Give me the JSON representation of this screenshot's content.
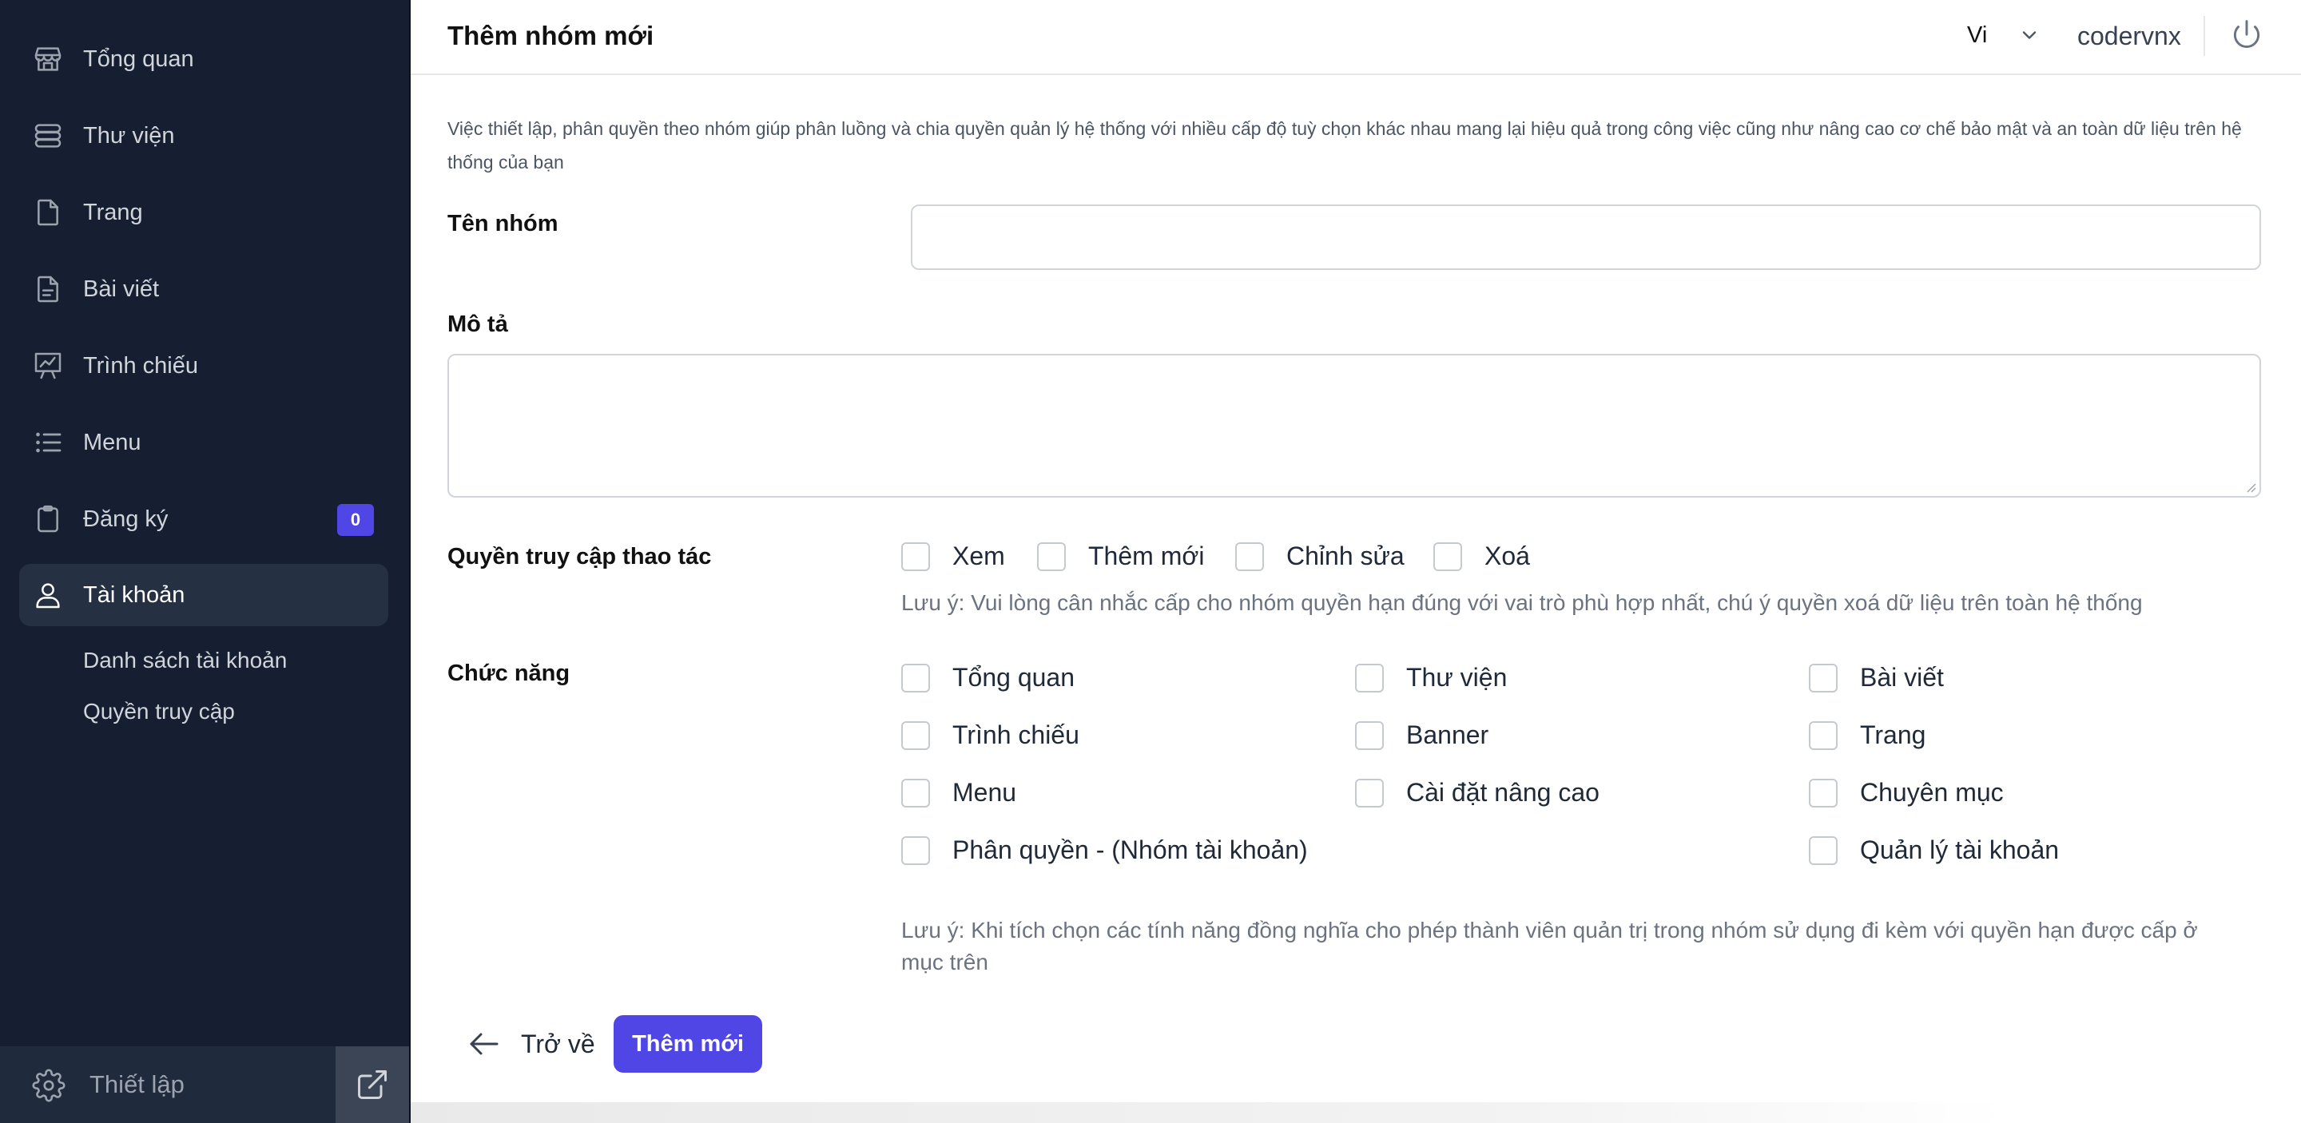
{
  "header": {
    "title": "Thêm nhóm mới",
    "language": "Vi",
    "username": "codervnx"
  },
  "sidebar": {
    "items": [
      {
        "label": "Tổng quan",
        "icon": "store-icon"
      },
      {
        "label": "Thư viện",
        "icon": "database-icon"
      },
      {
        "label": "Trang",
        "icon": "file-icon"
      },
      {
        "label": "Bài viết",
        "icon": "file-text-icon"
      },
      {
        "label": "Trình chiếu",
        "icon": "presentation-icon"
      },
      {
        "label": "Menu",
        "icon": "list-icon"
      },
      {
        "label": "Đăng ký",
        "icon": "clipboard-icon",
        "badge": "0"
      },
      {
        "label": "Tài khoản",
        "icon": "user-icon",
        "active": true
      }
    ],
    "subitems": [
      "Danh sách tài khoản",
      "Quyền truy cập"
    ],
    "settings_label": "Thiết lập"
  },
  "form": {
    "intro": "Việc thiết lập, phân quyền theo nhóm giúp phân luồng và chia quyền quản lý hệ thống với nhiều cấp độ tuỳ chọn khác nhau mang lại hiệu quả trong công việc cũng như nâng cao cơ chế bảo mật và an toàn dữ liệu trên hệ thống của bạn",
    "name_label": "Tên nhóm",
    "name_value": "",
    "desc_label": "Mô tả",
    "desc_value": "",
    "access_label": "Quyền truy cập thao tác",
    "access_options": [
      "Xem",
      "Thêm mới",
      "Chỉnh sửa",
      "Xoá"
    ],
    "access_note": "Lưu ý: Vui lòng cân nhắc cấp cho nhóm quyền hạn đúng với vai trò phù hợp nhất, chú ý quyền xoá dữ liệu trên toàn hệ thống",
    "features_label": "Chức năng",
    "features": [
      "Tổng quan",
      "Thư viện",
      "Bài viết",
      "Trình chiếu",
      "Banner",
      "Trang",
      "Menu",
      "Cài đặt nâng cao",
      "Chuyên mục",
      "Phân quyền - (Nhóm tài khoản)",
      "Quản lý tài khoản"
    ],
    "features_note_line1": "Lưu ý: Khi tích chọn các tính năng đồng nghĩa cho phép thành viên quản trị trong nhóm sử dụng đi kèm với quyền hạn được cấp ở",
    "features_note_line2": "mục trên",
    "back_label": "Trở về",
    "submit_label": "Thêm mới"
  },
  "colors": {
    "sidebar_bg": "#161f31",
    "accent": "#4f46e5"
  }
}
